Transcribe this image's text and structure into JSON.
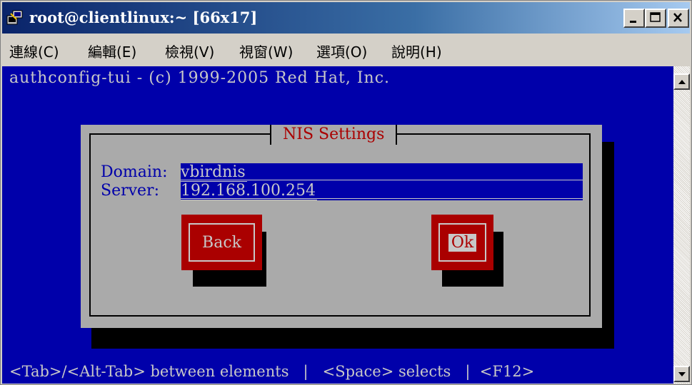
{
  "window": {
    "title": "root@clientlinux:~ [66x17]"
  },
  "menu": {
    "items": [
      {
        "label": "連線(C)"
      },
      {
        "label": "編輯(E)"
      },
      {
        "label": "檢視(V)"
      },
      {
        "label": "視窗(W)"
      },
      {
        "label": "選項(O)"
      },
      {
        "label": "說明(H)"
      }
    ]
  },
  "terminal": {
    "header": "authconfig-tui - (c) 1999-2005 Red Hat, Inc.",
    "status": "<Tab>/<Alt-Tab> between elements   |   <Space> selects   |  <F12>"
  },
  "dialog": {
    "title": "NIS Settings",
    "domain_label": "Domain:",
    "domain_value": "vbirdnis",
    "server_label": "Server:",
    "server_value": "192.168.100.254",
    "back_label": "Back",
    "ok_label": "Ok"
  },
  "colors": {
    "terminal_bg": "#0000aa",
    "dialog_bg": "#aaaaaa",
    "button_bg": "#aa0000",
    "title_text": "#aa0000"
  },
  "icons": {
    "app": "putty-terminal-icon",
    "minimize": "minimize-icon",
    "maximize": "maximize-icon",
    "close": "close-icon",
    "scroll_up": "arrow-up-icon",
    "scroll_down": "arrow-down-icon"
  }
}
